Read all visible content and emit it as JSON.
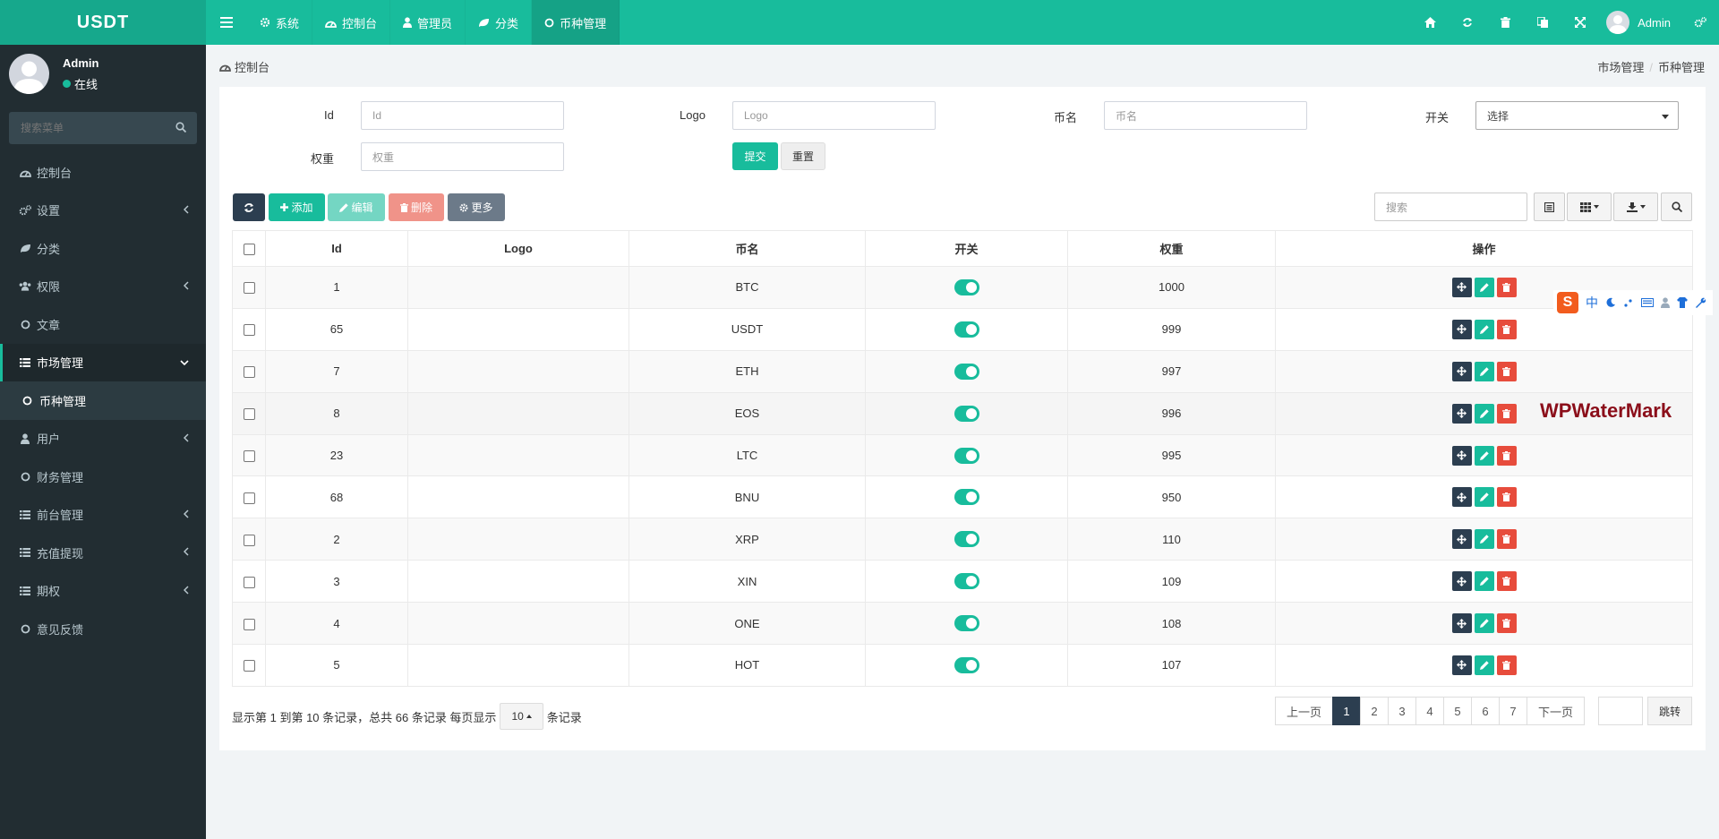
{
  "app": {
    "logo": "USDT"
  },
  "topnav": {
    "tabs": [
      {
        "label": "系统",
        "icon": "gear-icon"
      },
      {
        "label": "控制台",
        "icon": "dashboard-icon"
      },
      {
        "label": "管理员",
        "icon": "user-icon"
      },
      {
        "label": "分类",
        "icon": "leaf-icon"
      },
      {
        "label": "币种管理",
        "icon": "circle-o-icon",
        "active": true
      }
    ],
    "user_name": "Admin"
  },
  "sidebar": {
    "user": {
      "name": "Admin",
      "status": "在线"
    },
    "search_placeholder": "搜索菜单",
    "items": [
      {
        "label": "控制台",
        "icon": "dashboard-icon",
        "arrow": false
      },
      {
        "label": "设置",
        "icon": "cogs-icon",
        "arrow": true
      },
      {
        "label": "分类",
        "icon": "leaf-icon",
        "arrow": false
      },
      {
        "label": "权限",
        "icon": "group-icon",
        "arrow": true
      },
      {
        "label": "文章",
        "icon": "circle-o-icon",
        "arrow": false
      },
      {
        "label": "市场管理",
        "icon": "list-icon",
        "open": true
      },
      {
        "label": "币种管理",
        "icon": "circle-o-icon",
        "sub": true
      },
      {
        "label": "用户",
        "icon": "user-icon",
        "arrow": true
      },
      {
        "label": "财务管理",
        "icon": "circle-o-icon",
        "arrow": false
      },
      {
        "label": "前台管理",
        "icon": "list-icon",
        "arrow": true
      },
      {
        "label": "充值提现",
        "icon": "list-icon",
        "arrow": true
      },
      {
        "label": "期权",
        "icon": "list-icon",
        "arrow": true
      },
      {
        "label": "意见反馈",
        "icon": "circle-o-icon",
        "arrow": false
      }
    ]
  },
  "breadcrumb": {
    "left": "控制台",
    "right": [
      "市场管理",
      "币种管理"
    ]
  },
  "filter": {
    "id_label": "Id",
    "id_placeholder": "Id",
    "logo_label": "Logo",
    "logo_placeholder": "Logo",
    "name_label": "币名",
    "name_placeholder": "币名",
    "switch_label": "开关",
    "switch_value": "选择",
    "weight_label": "权重",
    "weight_placeholder": "权重",
    "submit": "提交",
    "reset": "重置"
  },
  "toolbar": {
    "add": "添加",
    "edit": "编辑",
    "delete": "删除",
    "more": "更多",
    "search_placeholder": "搜索"
  },
  "table": {
    "headers": [
      "Id",
      "Logo",
      "币名",
      "开关",
      "权重",
      "操作"
    ],
    "rows": [
      {
        "id": "1",
        "name": "BTC",
        "weight": "1000",
        "switch": true
      },
      {
        "id": "65",
        "name": "USDT",
        "weight": "999",
        "switch": true
      },
      {
        "id": "7",
        "name": "ETH",
        "weight": "997",
        "switch": true
      },
      {
        "id": "8",
        "name": "EOS",
        "weight": "996",
        "switch": true
      },
      {
        "id": "23",
        "name": "LTC",
        "weight": "995",
        "switch": true
      },
      {
        "id": "68",
        "name": "BNU",
        "weight": "950",
        "switch": true
      },
      {
        "id": "2",
        "name": "XRP",
        "weight": "110",
        "switch": true
      },
      {
        "id": "3",
        "name": "XIN",
        "weight": "109",
        "switch": true
      },
      {
        "id": "4",
        "name": "ONE",
        "weight": "108",
        "switch": true
      },
      {
        "id": "5",
        "name": "HOT",
        "weight": "107",
        "switch": true
      }
    ]
  },
  "pagination": {
    "info_prefix": "显示第 1 到第 10 条记录，总共 66 条记录 每页显示",
    "page_size": "10",
    "info_suffix": "条记录",
    "prev": "上一页",
    "pages": [
      "1",
      "2",
      "3",
      "4",
      "5",
      "6",
      "7"
    ],
    "current": "1",
    "next": "下一页",
    "jump": "跳转"
  },
  "watermark": "WPWaterMark",
  "ime": {
    "lang": "中"
  },
  "colors": {
    "primary": "#18bc9c",
    "dark": "#2c3e50",
    "danger": "#e74c3c",
    "sidebar": "#222d32"
  }
}
